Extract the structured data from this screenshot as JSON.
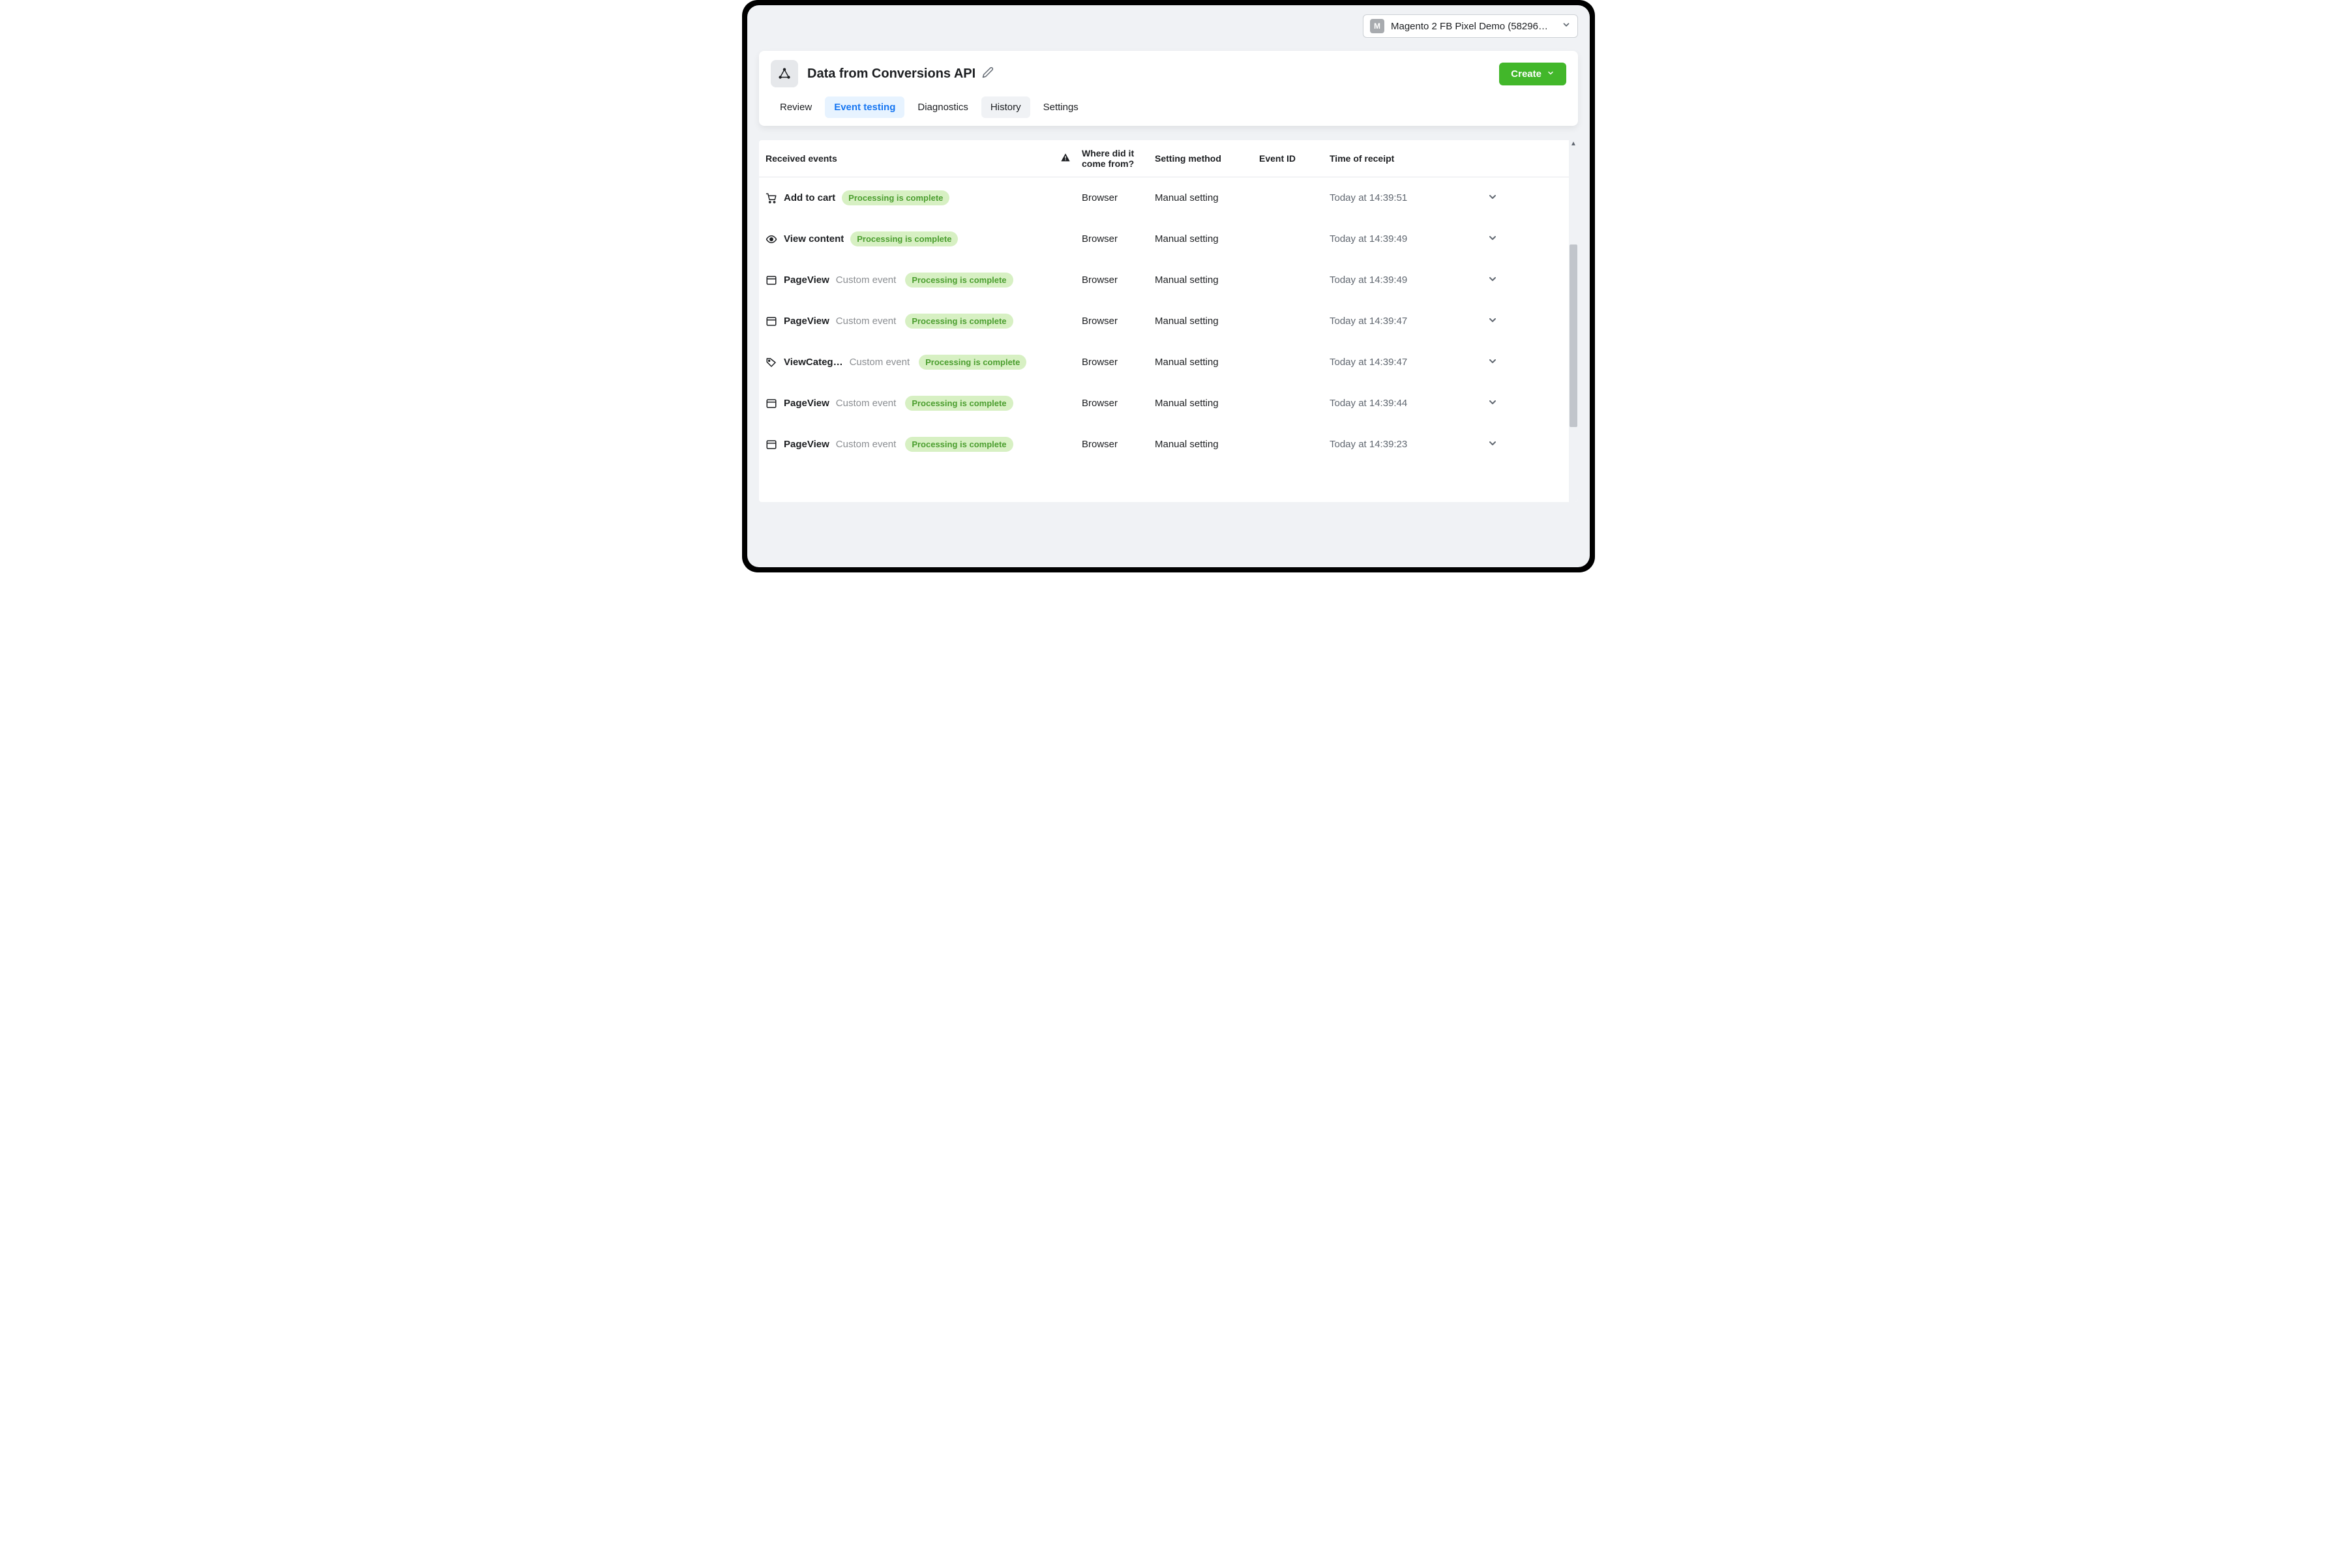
{
  "account_selector": {
    "badge_letter": "M",
    "label": "Magento 2 FB Pixel Demo (58296…"
  },
  "page_title": "Data from Conversions API",
  "create_button": "Create",
  "tabs": [
    {
      "label": "Review",
      "key": "review"
    },
    {
      "label": "Event testing",
      "key": "event-testing"
    },
    {
      "label": "Diagnostics",
      "key": "diagnostics"
    },
    {
      "label": "History",
      "key": "history"
    },
    {
      "label": "Settings",
      "key": "settings"
    }
  ],
  "active_tab": "event-testing",
  "hover_tab": "history",
  "columns": {
    "events": "Received events",
    "where": "Where did it come from?",
    "method": "Setting method",
    "event_id": "Event ID",
    "time": "Time of receipt"
  },
  "status_label": "Processing is complete",
  "rows": [
    {
      "icon": "cart",
      "name": "Add to cart",
      "subtype": "",
      "where": "Browser",
      "method": "Manual setting",
      "event_id": "",
      "time": "Today at 14:39:51"
    },
    {
      "icon": "eye",
      "name": "View content",
      "subtype": "",
      "where": "Browser",
      "method": "Manual setting",
      "event_id": "",
      "time": "Today at 14:39:49"
    },
    {
      "icon": "window",
      "name": "PageView",
      "subtype": "Custom event",
      "where": "Browser",
      "method": "Manual setting",
      "event_id": "",
      "time": "Today at 14:39:49"
    },
    {
      "icon": "window",
      "name": "PageView",
      "subtype": "Custom event",
      "where": "Browser",
      "method": "Manual setting",
      "event_id": "",
      "time": "Today at 14:39:47"
    },
    {
      "icon": "tag",
      "name": "ViewCateg…",
      "subtype": "Custom event",
      "where": "Browser",
      "method": "Manual setting",
      "event_id": "",
      "time": "Today at 14:39:47"
    },
    {
      "icon": "window",
      "name": "PageView",
      "subtype": "Custom event",
      "where": "Browser",
      "method": "Manual setting",
      "event_id": "",
      "time": "Today at 14:39:44"
    },
    {
      "icon": "window",
      "name": "PageView",
      "subtype": "Custom event",
      "where": "Browser",
      "method": "Manual setting",
      "event_id": "",
      "time": "Today at 14:39:23"
    }
  ]
}
